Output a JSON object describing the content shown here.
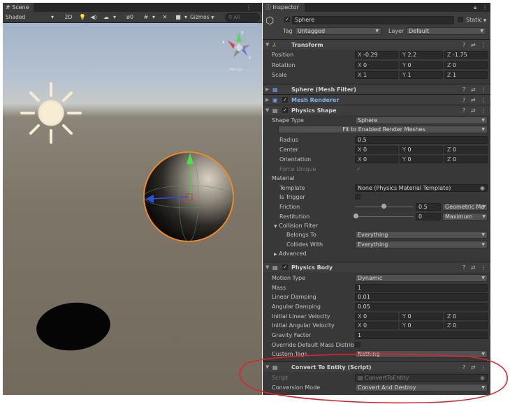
{
  "scene": {
    "tab_label": "Scene",
    "toolbar": {
      "shading": "Shaded",
      "mode_2d": "2D",
      "hidden_count": "0",
      "gizmos": "Gizmos",
      "search_placeholder": "All"
    },
    "persp_label": "Persp"
  },
  "inspector": {
    "tab_label": "Inspector",
    "object": {
      "name": "Sphere",
      "static_label": "Static",
      "tag_label": "Tag",
      "tag_value": "Untagged",
      "layer_label": "Layer",
      "layer_value": "Default"
    },
    "transform": {
      "title": "Transform",
      "position": {
        "label": "Position",
        "x": "-0.29",
        "y": "2.2",
        "z": "-1.75"
      },
      "rotation": {
        "label": "Rotation",
        "x": "0",
        "y": "0",
        "z": "0"
      },
      "scale": {
        "label": "Scale",
        "x": "1",
        "y": "1",
        "z": "1"
      }
    },
    "mesh_filter": {
      "title": "Sphere (Mesh Filter)"
    },
    "mesh_renderer": {
      "title": "Mesh Renderer"
    },
    "physics_shape": {
      "title": "Physics Shape",
      "shape_type_label": "Shape Type",
      "shape_type_value": "Sphere",
      "fit_button": "Fit to Enabled Render Meshes",
      "radius_label": "Radius",
      "radius_value": "0.5",
      "center": {
        "label": "Center",
        "x": "0",
        "y": "0",
        "z": "0"
      },
      "orientation": {
        "label": "Orientation",
        "x": "0",
        "y": "0",
        "z": "0"
      },
      "force_unique_label": "Force Unique",
      "material_label": "Material",
      "template_label": "Template",
      "template_value": "None (Physics Material Template)",
      "is_trigger_label": "Is Trigger",
      "friction_label": "Friction",
      "friction_value": "0.5",
      "friction_mode": "Geometric Me",
      "restitution_label": "Restitution",
      "restitution_value": "0",
      "restitution_mode": "Maximum",
      "collision_filter_label": "Collision Filter",
      "belongs_to_label": "Belongs To",
      "belongs_to_value": "Everything",
      "collides_with_label": "Collides With",
      "collides_with_value": "Everything",
      "advanced_label": "Advanced"
    },
    "physics_body": {
      "title": "Physics Body",
      "motion_type_label": "Motion Type",
      "motion_type_value": "Dynamic",
      "mass_label": "Mass",
      "mass_value": "1",
      "linear_damping_label": "Linear Damping",
      "linear_damping_value": "0.01",
      "angular_damping_label": "Angular Damping",
      "angular_damping_value": "0.05",
      "initial_linear_velocity": {
        "label": "Initial Linear Velocity",
        "x": "0",
        "y": "0",
        "z": "0"
      },
      "initial_angular_velocity": {
        "label": "Initial Angular Velocity",
        "x": "0",
        "y": "0",
        "z": "0"
      },
      "gravity_factor_label": "Gravity Factor",
      "gravity_factor_value": "1",
      "override_mass_label": "Override Default Mass Distrib",
      "custom_tags_label": "Custom Tags",
      "custom_tags_value": "Nothing"
    },
    "convert_to_entity": {
      "title": "Convert To Entity (Script)",
      "script_label": "Script",
      "script_value": "ConvertToEntity",
      "conversion_mode_label": "Conversion Mode",
      "conversion_mode_value": "Convert And Destroy"
    }
  },
  "colors": {
    "annotation_red": "#e0242a",
    "sphere_outline": "#f08a24",
    "sun": "#f8ecd4",
    "panel_bg": "#383838"
  }
}
